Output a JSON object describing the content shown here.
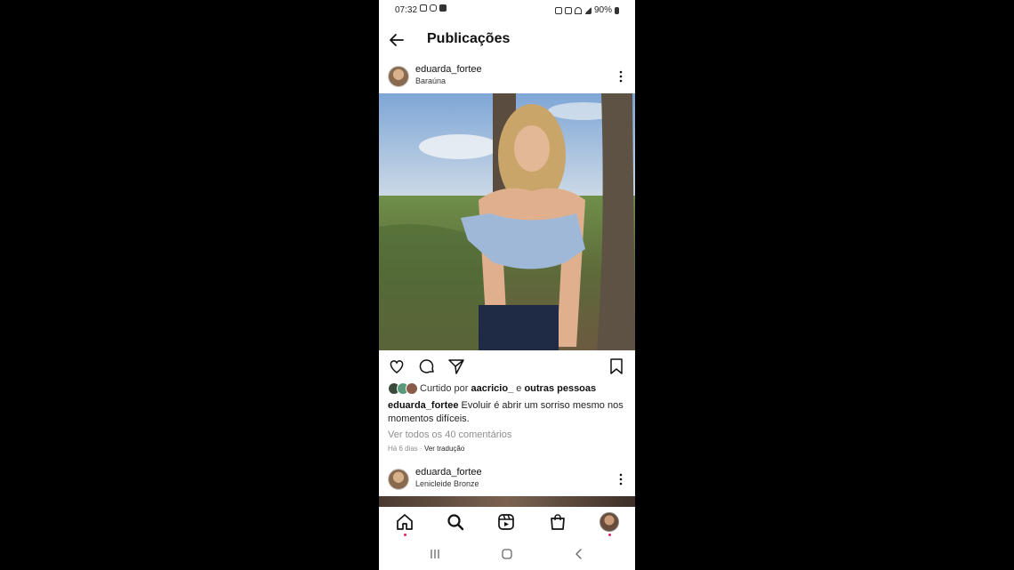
{
  "status_bar": {
    "time": "07:32",
    "battery": "90%"
  },
  "header": {
    "title": "Publicações"
  },
  "post1": {
    "username": "eduarda_fortee",
    "location": "Baraúna",
    "liked_prefix": "Curtido por",
    "liked_user": "aacricio_",
    "liked_joiner": "e",
    "liked_others": "outras pessoas",
    "caption_user": "eduarda_fortee",
    "caption_text": "Evoluir é abrir um sorriso mesmo nos momentos difíceis.",
    "comments_link": "Ver todos os 40 comentários",
    "time_ago": "Há 6 dias",
    "separator": "·",
    "translate_link": "Ver tradução"
  },
  "post2": {
    "username": "eduarda_fortee",
    "location": "Lenicleide Bronze"
  },
  "icons": {
    "back": "arrow-left-icon",
    "more": "three-dots-vertical-icon",
    "like": "heart-icon",
    "comment": "comment-bubble-icon",
    "share": "paper-plane-icon",
    "save": "bookmark-icon",
    "home": "home-icon",
    "search": "search-icon",
    "reels": "reels-icon",
    "shop": "shopping-bag-icon",
    "profile": "profile-avatar-icon"
  },
  "colors": {
    "notification_dot": "#e0245e",
    "secondary_text": "#8e8e8e"
  }
}
